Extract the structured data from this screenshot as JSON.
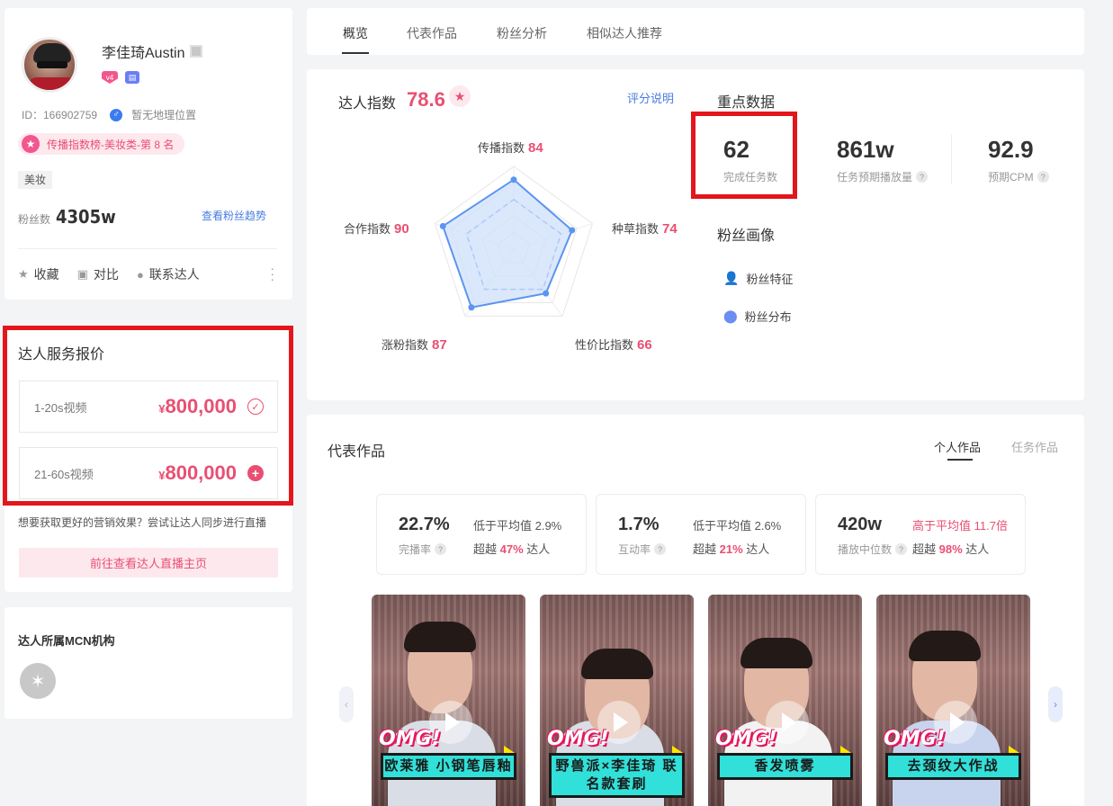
{
  "profile": {
    "name": "李佳琦Austin",
    "level_badge": "v4",
    "id_text": "ID：166902759",
    "location": "暂无地理位置",
    "rank_text": "传播指数榜-美妆类-第 8 名",
    "tag": "美妆",
    "fans_label": "粉丝数",
    "fans_value": "4305w",
    "trend_link": "查看粉丝趋势",
    "actions": {
      "collect": "收藏",
      "compare": "对比",
      "contact": "联系达人"
    },
    "icons": {
      "avatar": "avatar",
      "qr": "qr-code-icon",
      "gender": "male-icon",
      "shop": "cart-icon",
      "star": "star-icon"
    }
  },
  "price": {
    "title": "达人服务报价",
    "options": [
      {
        "duration": "1-20s视频",
        "currency": "¥",
        "amount": "800,000",
        "icon": "check-circle-icon"
      },
      {
        "duration": "21-60s视频",
        "currency": "¥",
        "amount": "800,000",
        "icon": "plus-circle-icon"
      }
    ],
    "tip": "想要获取更好的营销效果？尝试让达人同步进行直播",
    "button": "前往查看达人直播主页"
  },
  "mcn": {
    "title": "达人所属MCN机构"
  },
  "tabs": [
    "概览",
    "代表作品",
    "粉丝分析",
    "相似达人推荐"
  ],
  "index": {
    "label": "达人指数",
    "score": "78.6",
    "help_link": "评分说明",
    "radar": [
      {
        "name": "传播指数",
        "value": 84
      },
      {
        "name": "种草指数",
        "value": 74
      },
      {
        "name": "性价比指数",
        "value": 66
      },
      {
        "name": "涨粉指数",
        "value": 87
      },
      {
        "name": "合作指数",
        "value": 90
      }
    ],
    "key_title": "重点数据",
    "key_data": [
      {
        "value": "62",
        "label": "完成任务数"
      },
      {
        "value": "861w",
        "label": "任务预期播放量"
      },
      {
        "value": "92.9",
        "label": "预期CPM"
      }
    ],
    "fans_portrait_title": "粉丝画像",
    "fans_portrait": [
      "粉丝特征",
      "粉丝分布"
    ]
  },
  "works": {
    "title": "代表作品",
    "tabs": [
      "个人作品",
      "任务作品"
    ],
    "stats": [
      {
        "value": "22.7%",
        "label": "完播率",
        "compare": "低于平均值 2.9%",
        "beat_prefix": "超越",
        "beat": "47%",
        "beat_suffix": "达人",
        "compare_high": false
      },
      {
        "value": "1.7%",
        "label": "互动率",
        "compare": "低于平均值 2.6%",
        "beat_prefix": "超越",
        "beat": "21%",
        "beat_suffix": "达人",
        "compare_high": false
      },
      {
        "value": "420w",
        "label": "播放中位数",
        "compare": "高于平均值 11.7倍",
        "beat_prefix": "超越",
        "beat": "98%",
        "beat_suffix": "达人",
        "compare_high": true
      }
    ],
    "videos": [
      {
        "badge": "OMG!",
        "caption": "欧莱雅 小钢笔唇釉"
      },
      {
        "badge": "OMG!",
        "caption": "野兽派×李佳琦 联名款套刷"
      },
      {
        "badge": "OMG!",
        "caption": "香发喷雾"
      },
      {
        "badge": "OMG!",
        "caption": "去颈纹大作战"
      }
    ]
  },
  "colors": {
    "accent": "#e94f72",
    "link": "#4a7de0",
    "highlight_box": "#e3161b",
    "radar_fill": "#cfe0fb",
    "radar_stroke": "#5b95f0"
  }
}
